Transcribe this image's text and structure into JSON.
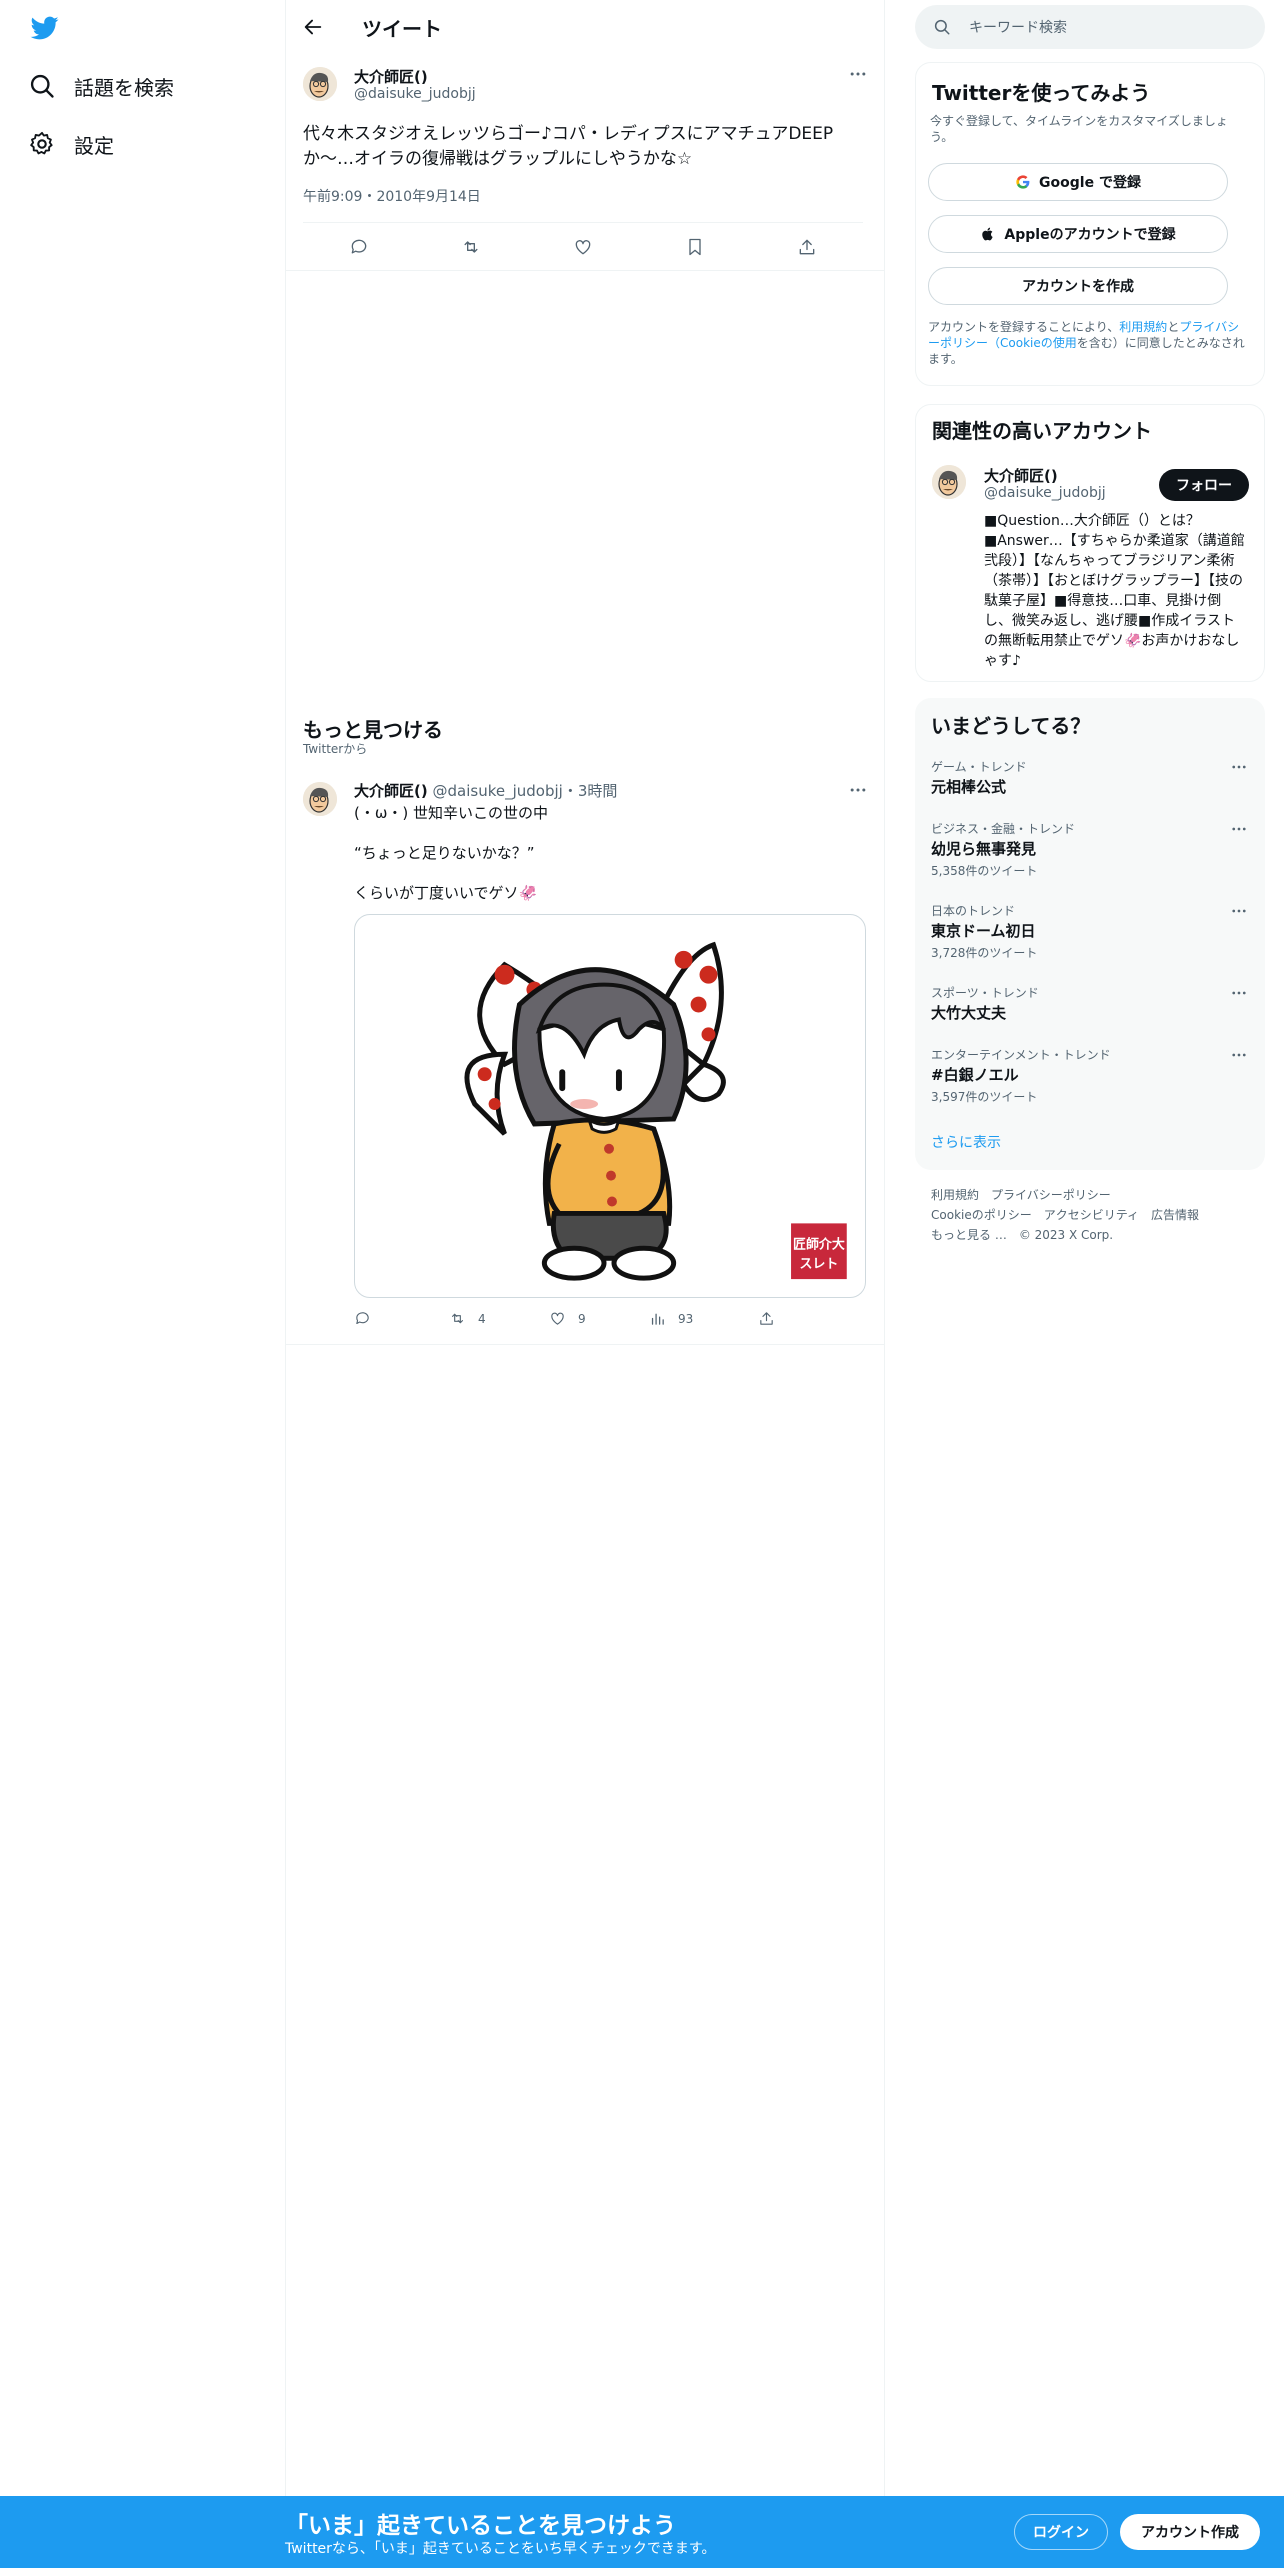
{
  "nav": {
    "items": [
      {
        "label": "話題を検索",
        "icon": "search-icon"
      },
      {
        "label": "設定",
        "icon": "gear-icon"
      }
    ]
  },
  "header": {
    "title": "ツイート"
  },
  "tweet": {
    "author_name": "大介師匠()",
    "author_handle": "@daisuke_judobjj",
    "text_line1": "代々木スタジオえレッツらゴー♪コパ・レディプスにアマチュアDEEP",
    "text_line2": "か〜…オイラの復帰戦はグラップルにしやうかな☆",
    "timestamp": "午前9:09・2010年9月14日"
  },
  "discover": {
    "title": "もっと見つける",
    "subtitle": "Twitterから"
  },
  "related_tweet": {
    "author_name": "大介師匠()",
    "author_handle": "@daisuke_judobjj",
    "time": "・3時間",
    "line1": "(・ω・) 世知辛いこの世の中",
    "line2": "“ちょっと足りないかな？”",
    "line3": "くらいが丁度いいでゲソ🦑",
    "stamp_text": "匠師介大 スレト",
    "retweets": "4",
    "likes": "9",
    "views": "93"
  },
  "search": {
    "placeholder": "キーワード検索"
  },
  "signup_card": {
    "title": "Twitterを使ってみよう",
    "description": "今すぐ登録して、タイムラインをカスタマイズしましょう。",
    "google_label": "Google で登録",
    "apple_label": "Appleのアカウントで登録",
    "create_label": "アカウントを作成",
    "legal_prefix": "アカウントを登録することにより、",
    "legal_terms": "利用規約",
    "legal_and": "と",
    "legal_privacy": "プライバシーポリシー（Cookieの使用",
    "legal_suffix": "を含む）に同意したとみなされます。"
  },
  "relevant": {
    "title": "関連性の高いアカウント",
    "name": "大介師匠()",
    "handle": "@daisuke_judobjj",
    "follow_label": "フォロー",
    "bio": "■Question…大介師匠（）とは？■Answer…【すちゃらか柔道家（講道館弐段）】【なんちゃってブラジリアン柔術（茶帯）】【おとぼけグラップラー】【技の駄菓子屋】■得意技…口車、見掛け倒し、微笑み返し、逃げ腰■作成イラストの無断転用禁止でゲソ🦑お声かけおなしゃす♪"
  },
  "trends": {
    "title": "いまどうしてる？",
    "items": [
      {
        "category": "ゲーム・トレンド",
        "name": "元相棒公式",
        "count": ""
      },
      {
        "category": "ビジネス・金融・トレンド",
        "name": "幼児ら無事発見",
        "count": "5,358件のツイート"
      },
      {
        "category": "日本のトレンド",
        "name": "東京ドーム初日",
        "count": "3,728件のツイート"
      },
      {
        "category": "スポーツ・トレンド",
        "name": "大竹大丈夫",
        "count": ""
      },
      {
        "category": "エンターテインメント・トレンド",
        "name": "#白銀ノエル",
        "count": "3,597件のツイート"
      }
    ],
    "show_more": "さらに表示"
  },
  "footer": {
    "links": [
      "利用規約",
      "プライバシーポリシー",
      "Cookieのポリシー",
      "アクセシビリティ",
      "広告情報",
      "もっと見る …",
      "© 2023 X Corp."
    ]
  },
  "banner": {
    "title": "「いま」起きていることを見つけよう",
    "subtitle": "Twitterなら、「いま」起きていることをいち早くチェックできます。",
    "login_label": "ログイン",
    "signup_label": "アカウント作成"
  },
  "colors": {
    "accent": "#1d9bf0",
    "text": "#0f1419",
    "muted": "#536471",
    "border": "#eff3f4"
  }
}
